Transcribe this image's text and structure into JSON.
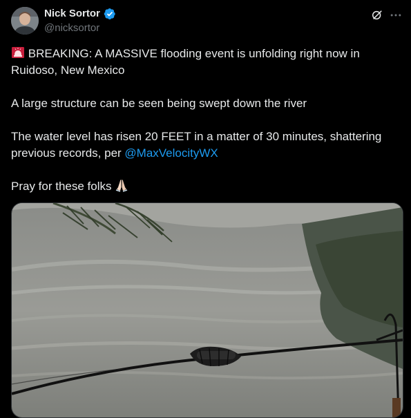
{
  "author": {
    "name": "Nick Sortor",
    "handle": "@nicksortor",
    "verified": true
  },
  "icons": {
    "avatar": "avatar-photo",
    "verified": "verified-badge-icon",
    "grok": "grok-icon",
    "more": "more-options-icon",
    "siren": "rotating-light-emoji",
    "pray": "folded-hands-emoji"
  },
  "tweet": {
    "line1": "BREAKING: A MASSIVE flooding event is unfolding right now in Ruidoso, New Mexico",
    "line2": "A large structure can be seen being swept down the river",
    "line3_prefix": "The water level has risen 20 FEET in a matter of 30 minutes, shattering previous records, per ",
    "mention": "@MaxVelocityWX",
    "line4": "Pray for these folks"
  },
  "colors": {
    "background": "#000000",
    "text": "#e7e9ea",
    "muted": "#71767b",
    "accent": "#1d9bf0"
  },
  "media": {
    "type": "image",
    "subject": "flooded river with power line in foreground"
  }
}
